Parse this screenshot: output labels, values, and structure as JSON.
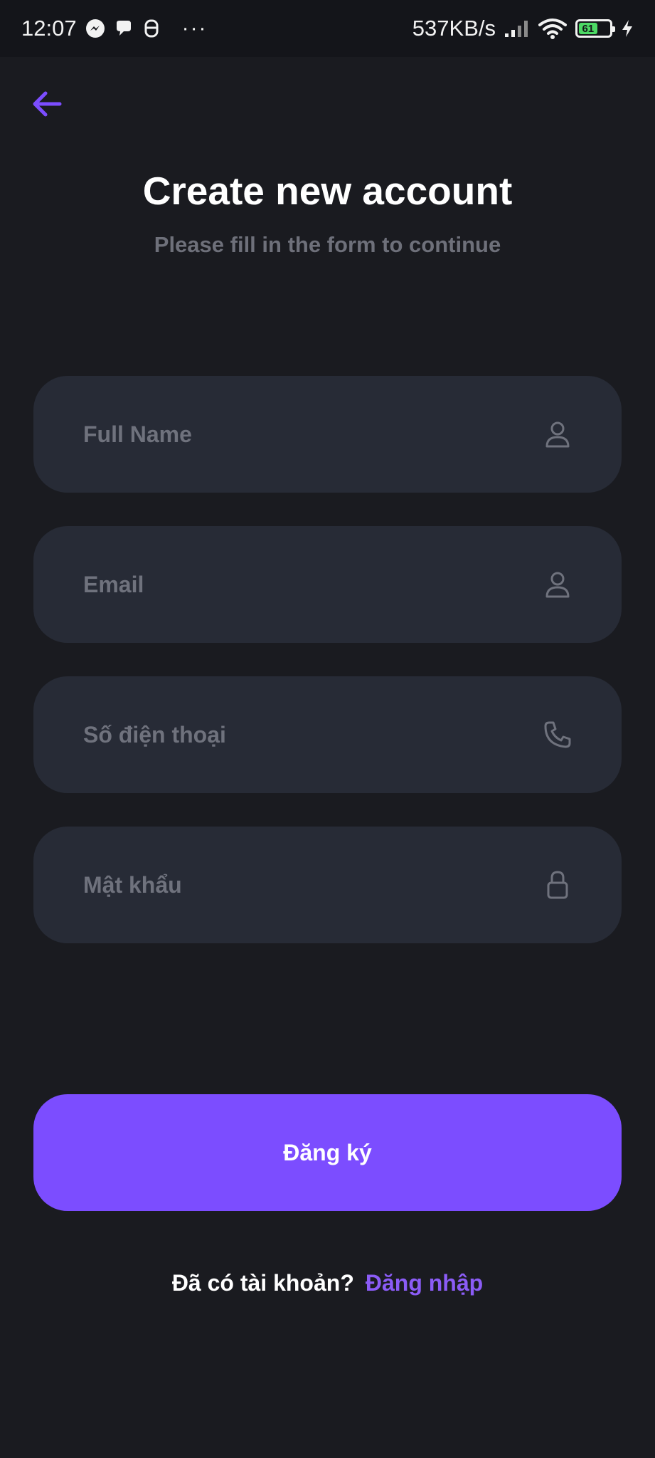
{
  "status_bar": {
    "time": "12:07",
    "net_speed": "537KB/s",
    "battery_level": "61",
    "battery_fraction": 0.61,
    "left_icons": [
      "messenger-icon",
      "chat-bubble-icon",
      "app-notification-icon"
    ],
    "right_icons": [
      "signal-bars-icon",
      "wifi-icon",
      "battery-icon",
      "charging-bolt-icon"
    ],
    "more": "···"
  },
  "header": {
    "back_icon": "arrow-left-icon",
    "title": "Create new account",
    "subtitle": "Please fill in the form to continue"
  },
  "form": {
    "full_name": {
      "placeholder": "Full Name",
      "value": "",
      "icon": "user-icon"
    },
    "email": {
      "placeholder": "Email",
      "value": "",
      "icon": "user-icon"
    },
    "phone": {
      "placeholder": "Số điện thoại",
      "value": "",
      "icon": "phone-icon"
    },
    "password": {
      "placeholder": "Mật khẩu",
      "value": "",
      "icon": "lock-icon"
    }
  },
  "actions": {
    "register_label": "Đăng ký",
    "have_account_prompt": "Đã có tài khoản?",
    "login_label": "Đăng nhập"
  },
  "colors": {
    "background": "#1a1b20",
    "status_bar": "#14151a",
    "field_background": "#272b36",
    "accent": "#7c4dff",
    "link": "#8b5cf6",
    "placeholder": "#6f727d"
  }
}
